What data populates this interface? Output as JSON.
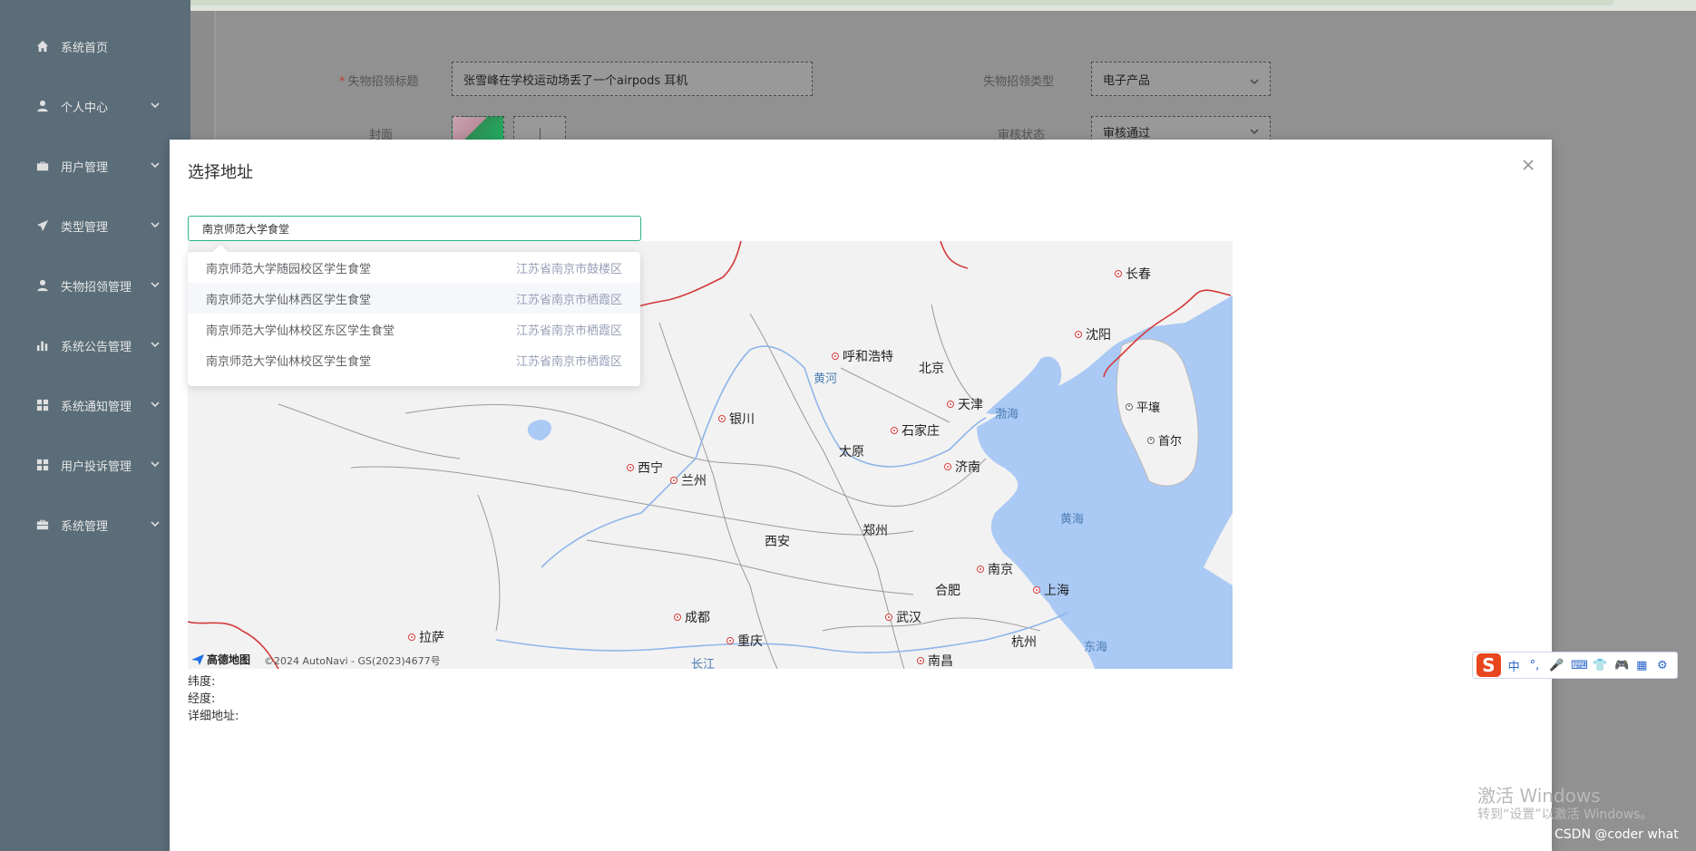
{
  "sidebar": {
    "items": [
      {
        "label": "系统首页",
        "icon": "home-icon",
        "has_children": false
      },
      {
        "label": "个人中心",
        "icon": "user-icon",
        "has_children": true
      },
      {
        "label": "用户管理",
        "icon": "suitcase-icon",
        "has_children": true
      },
      {
        "label": "类型管理",
        "icon": "send-icon",
        "has_children": true
      },
      {
        "label": "失物招领管理",
        "icon": "user-icon",
        "has_children": true
      },
      {
        "label": "系统公告管理",
        "icon": "bar-chart-icon",
        "has_children": true
      },
      {
        "label": "系统通知管理",
        "icon": "grid-icon",
        "has_children": true
      },
      {
        "label": "用户投诉管理",
        "icon": "grid-icon",
        "has_children": true
      },
      {
        "label": "系统管理",
        "icon": "briefcase-icon",
        "has_children": true
      }
    ]
  },
  "form": {
    "title_label": "失物招领标题",
    "title_value": "张雪峰在学校运动场丢了一个airpods 耳机",
    "type_label": "失物招领类型",
    "type_value": "电子产品",
    "cover_label": "封面",
    "status_label": "审核状态",
    "status_value": "审核通过"
  },
  "dialog": {
    "title": "选择地址",
    "search_value": "南京师范大学食堂",
    "suggestions": [
      {
        "name": "南京师范大学随园校区学生食堂",
        "address": "江苏省南京市鼓楼区"
      },
      {
        "name": "南京师范大学仙林西区学生食堂",
        "address": "江苏省南京市栖霞区"
      },
      {
        "name": "南京师范大学仙林校区东区学生食堂",
        "address": "江苏省南京市栖霞区"
      },
      {
        "name": "南京师范大学仙林校区学生食堂",
        "address": "江苏省南京市栖霞区"
      }
    ],
    "latitude_label": "纬度:",
    "longitude_label": "经度:",
    "address_label": "详细地址:"
  },
  "map": {
    "cities": [
      "长春",
      "沈阳",
      "呼和浩特",
      "北京",
      "天津",
      "平壤",
      "首尔",
      "银川",
      "石家庄",
      "太原",
      "西宁",
      "兰州",
      "济南",
      "郑州",
      "西安",
      "南京",
      "合肥",
      "上海",
      "成都",
      "武汉",
      "拉萨",
      "重庆",
      "杭州",
      "南昌"
    ],
    "water_labels": [
      "黄河",
      "渤海",
      "黄海",
      "东海",
      "长江"
    ],
    "logo_text": "高德地图",
    "copyright": "©2024 AutoNavi - GS(2023)4677号"
  },
  "ime": {
    "logo": "S",
    "keys": [
      "中",
      "°,",
      "🎤",
      "⌨",
      "👕",
      "🎮",
      "▦",
      "⚙"
    ]
  },
  "system": {
    "watermark_title": "激活 Windows",
    "watermark_sub": "转到“设置”以激活 Windows。",
    "credit": "CSDN @coder what"
  },
  "colors": {
    "accent": "#2db38f",
    "city_dot": "#d23a3a",
    "water": "#aac9f4",
    "border_red": "#d33a3a"
  }
}
